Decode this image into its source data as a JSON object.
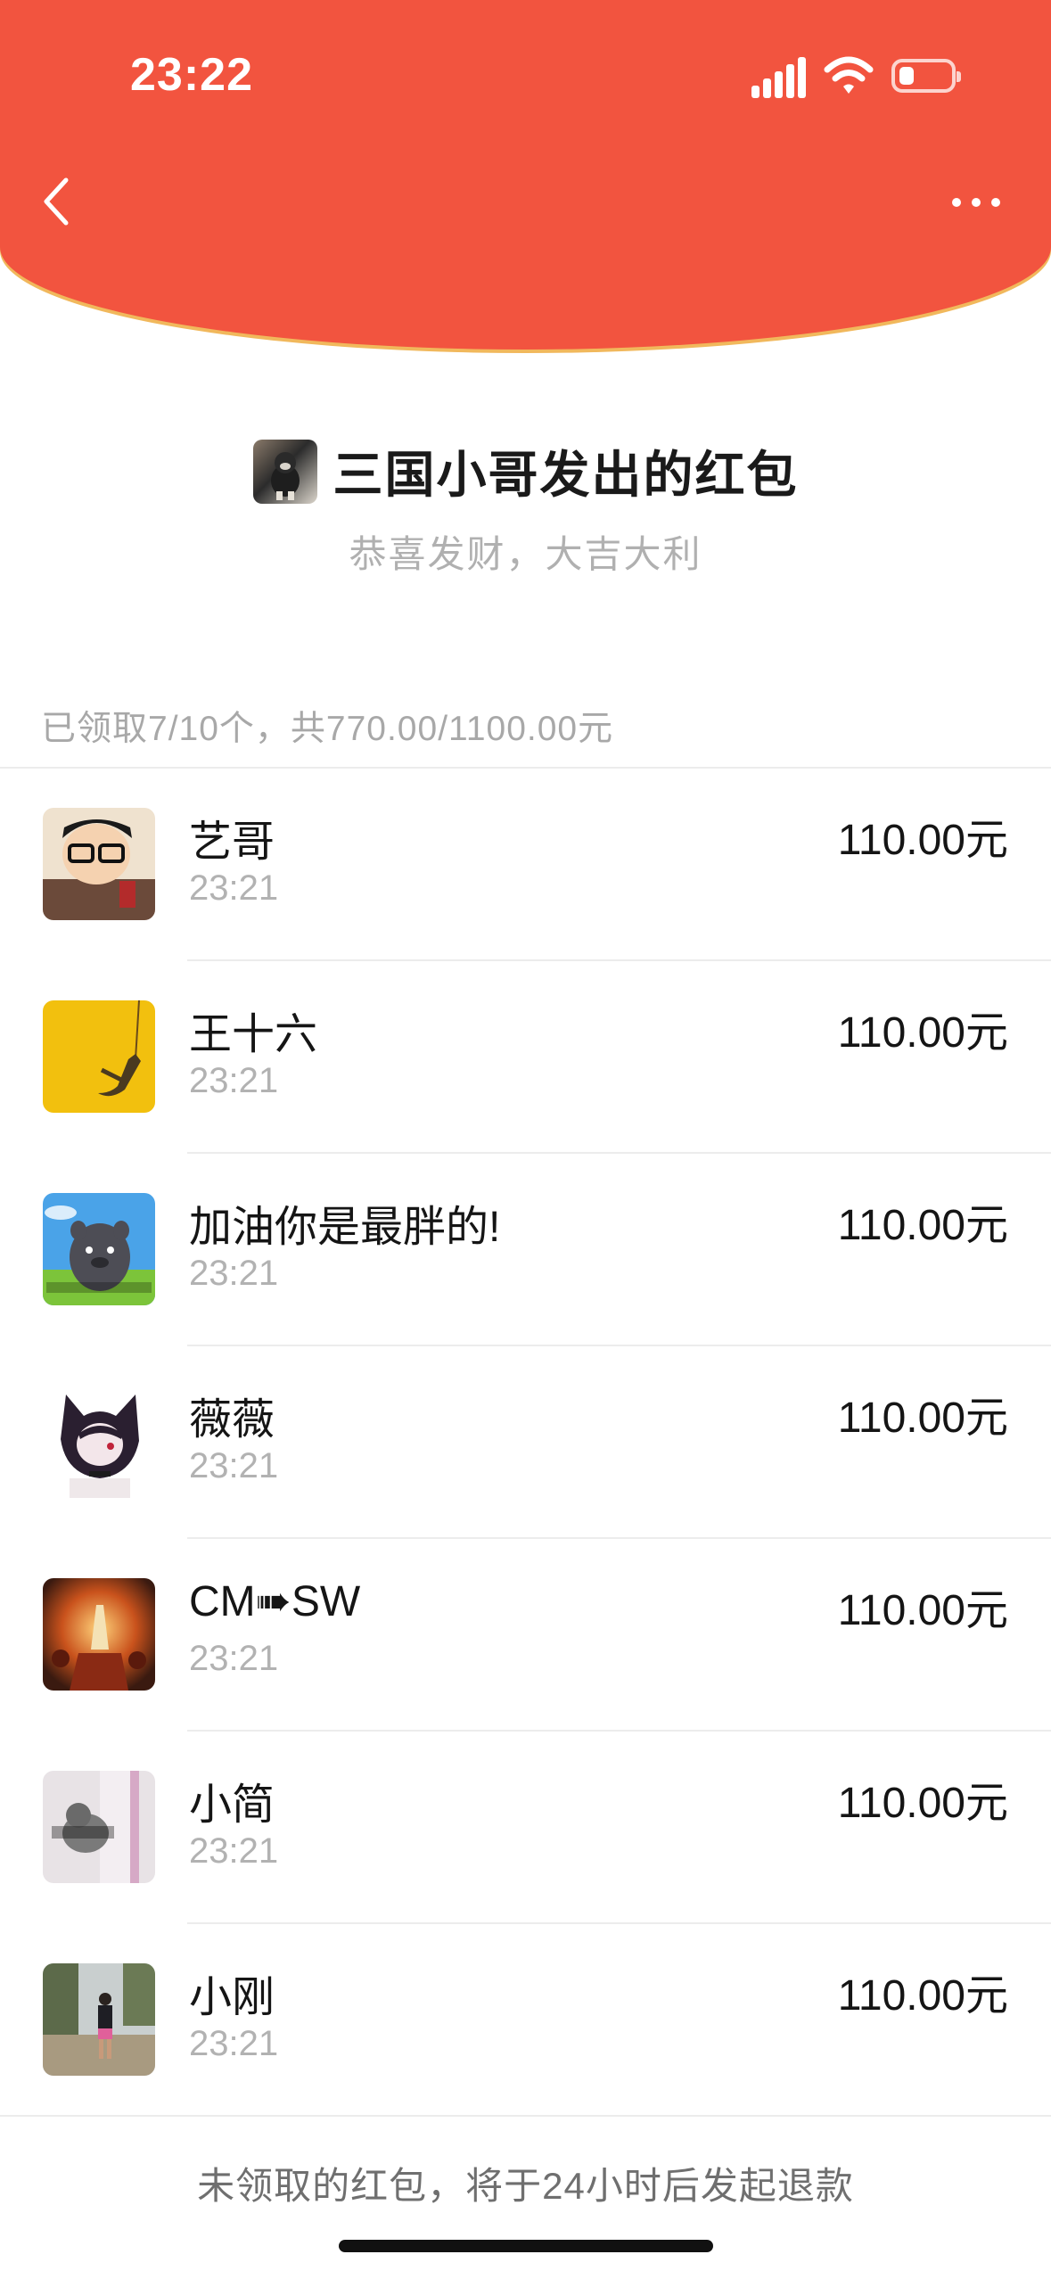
{
  "status_bar": {
    "time": "23:22"
  },
  "header": {
    "color": "#F2543F",
    "trim_color": "#F1B85C"
  },
  "sender": {
    "title": "三国小哥发出的红包",
    "greeting": "恭喜发财，大吉大利"
  },
  "summary": "已领取7/10个，共770.00/1100.00元",
  "recipients": [
    {
      "name": "艺哥",
      "time": "23:21",
      "amount": "110.00元"
    },
    {
      "name": "王十六",
      "time": "23:21",
      "amount": "110.00元"
    },
    {
      "name": "加油你是最胖的!",
      "time": "23:21",
      "amount": "110.00元"
    },
    {
      "name": "薇薇",
      "time": "23:21",
      "amount": "110.00元"
    },
    {
      "name": "CM➠SW",
      "time": "23:21",
      "amount": "110.00元"
    },
    {
      "name": "小简",
      "time": "23:21",
      "amount": "110.00元"
    },
    {
      "name": "小刚",
      "time": "23:21",
      "amount": "110.00元"
    }
  ],
  "footer_note": "未领取的红包，将于24小时后发起退款"
}
